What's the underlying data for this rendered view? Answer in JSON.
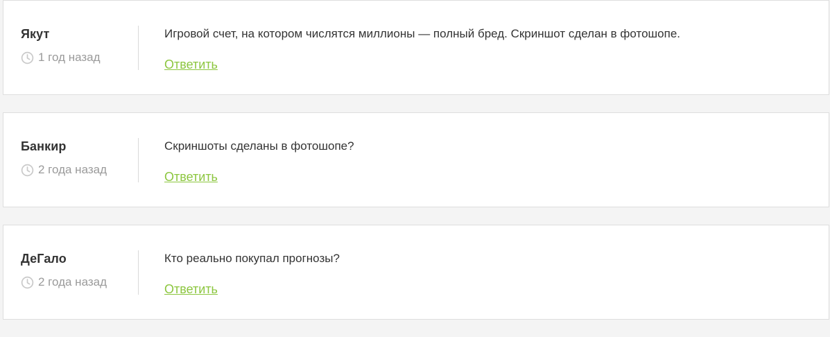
{
  "comments": [
    {
      "author": "Якут",
      "time": "1 год назад",
      "text": "Игровой счет, на котором числятся миллионы — полный бред. Скриншот сделан в фотошопе.",
      "reply_label": "Ответить"
    },
    {
      "author": "Банкир",
      "time": "2 года назад",
      "text": "Скриншоты сделаны в фотошопе?",
      "reply_label": "Ответить"
    },
    {
      "author": "ДеГало",
      "time": "2 года назад",
      "text": "Кто реально покупал прогнозы?",
      "reply_label": "Ответить"
    }
  ],
  "icons": {
    "time": "clock-icon"
  },
  "colors": {
    "accent": "#8cc63f",
    "muted": "#9a9a9a",
    "text": "#333333",
    "background": "#f4f4f4"
  }
}
